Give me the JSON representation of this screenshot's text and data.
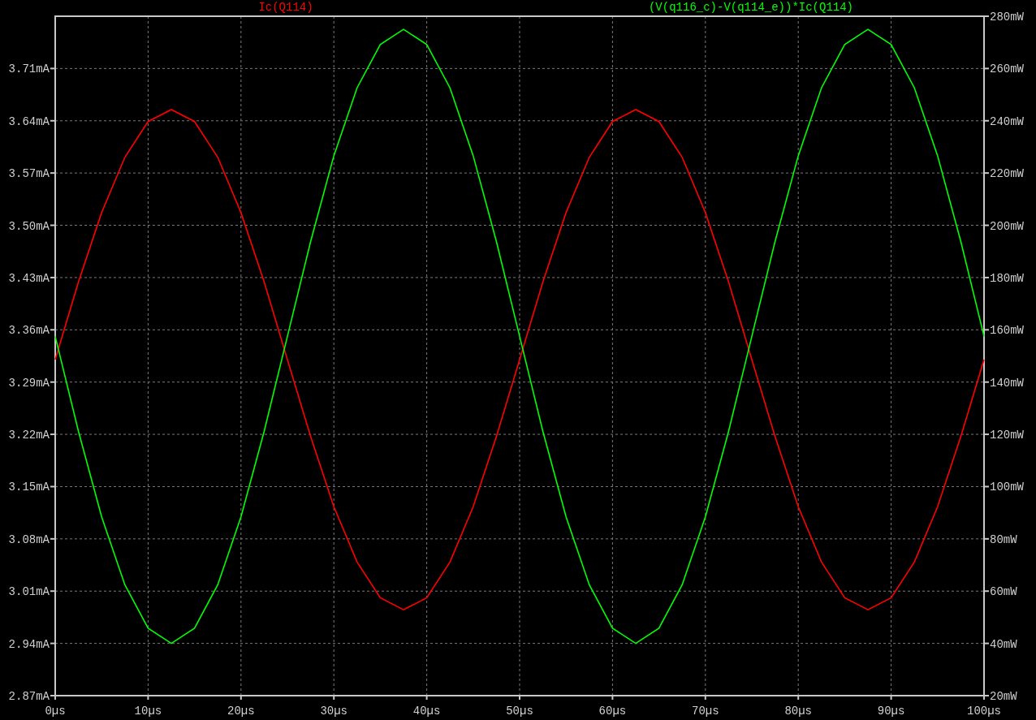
{
  "plot": {
    "chart_data": {
      "type": "line",
      "grid": true,
      "x": [
        0,
        2.5,
        5,
        7.5,
        10,
        12.5,
        15,
        17.5,
        20,
        22.5,
        25,
        27.5,
        30,
        32.5,
        35,
        37.5,
        40,
        42.5,
        45,
        47.5,
        50,
        52.5,
        55,
        57.5,
        60,
        62.5,
        65,
        67.5,
        70,
        72.5,
        75,
        77.5,
        80,
        82.5,
        85,
        87.5,
        90,
        92.5,
        95,
        97.5,
        100
      ],
      "xlim": [
        0,
        100
      ],
      "xticks": [
        {
          "value": 0,
          "label": "0µs"
        },
        {
          "value": 10,
          "label": "10µs"
        },
        {
          "value": 20,
          "label": "20µs"
        },
        {
          "value": 30,
          "label": "30µs"
        },
        {
          "value": 40,
          "label": "40µs"
        },
        {
          "value": 50,
          "label": "50µs"
        },
        {
          "value": 60,
          "label": "60µs"
        },
        {
          "value": 70,
          "label": "70µs"
        },
        {
          "value": 80,
          "label": "80µs"
        },
        {
          "value": 90,
          "label": "90µs"
        },
        {
          "value": 100,
          "label": "100µs"
        }
      ],
      "ylim": [
        2.87,
        3.78
      ],
      "yticks": [
        {
          "value": 2.87,
          "label": "2.87mA"
        },
        {
          "value": 2.94,
          "label": "2.94mA"
        },
        {
          "value": 3.01,
          "label": "3.01mA"
        },
        {
          "value": 3.08,
          "label": "3.08mA"
        },
        {
          "value": 3.15,
          "label": "3.15mA"
        },
        {
          "value": 3.22,
          "label": "3.22mA"
        },
        {
          "value": 3.29,
          "label": "3.29mA"
        },
        {
          "value": 3.36,
          "label": "3.36mA"
        },
        {
          "value": 3.43,
          "label": "3.43mA"
        },
        {
          "value": 3.5,
          "label": "3.50mA"
        },
        {
          "value": 3.57,
          "label": "3.57mA"
        },
        {
          "value": 3.64,
          "label": "3.64mA"
        },
        {
          "value": 3.71,
          "label": "3.71mA"
        }
      ],
      "y2lim": [
        20,
        280
      ],
      "y2ticks": [
        {
          "value": 20,
          "label": "20mW"
        },
        {
          "value": 40,
          "label": "40mW"
        },
        {
          "value": 60,
          "label": "60mW"
        },
        {
          "value": 80,
          "label": "80mW"
        },
        {
          "value": 100,
          "label": "100mW"
        },
        {
          "value": 120,
          "label": "120mW"
        },
        {
          "value": 140,
          "label": "140mW"
        },
        {
          "value": 160,
          "label": "160mW"
        },
        {
          "value": 180,
          "label": "180mW"
        },
        {
          "value": 200,
          "label": "200mW"
        },
        {
          "value": 220,
          "label": "220mW"
        },
        {
          "value": 240,
          "label": "240mW"
        },
        {
          "value": 260,
          "label": "260mW"
        },
        {
          "value": 280,
          "label": "280mW"
        }
      ],
      "series": [
        {
          "name": "Ic(Q114)",
          "color": "#ff0000",
          "values": [
            3.32,
            3.424,
            3.517,
            3.591,
            3.639,
            3.655,
            3.639,
            3.591,
            3.517,
            3.424,
            3.32,
            3.217,
            3.123,
            3.049,
            3.001,
            2.985,
            3.001,
            3.049,
            3.123,
            3.217,
            3.32,
            3.424,
            3.517,
            3.591,
            3.639,
            3.655,
            3.639,
            3.591,
            3.517,
            3.424,
            3.32,
            3.217,
            3.123,
            3.049,
            3.001,
            2.985,
            3.001,
            3.049,
            3.123,
            3.217,
            3.32
          ]
        },
        {
          "name": "(V(q116_c)-V(q114_e))*Ic(Q114)",
          "color": "#00ff00",
          "axis": "y2",
          "values": [
            157.5,
            121.2,
            88.4,
            62.4,
            45.8,
            40,
            45.8,
            62.4,
            88.4,
            121.2,
            157.5,
            193.8,
            226.6,
            252.6,
            269.2,
            275,
            269.2,
            252.6,
            226.6,
            193.8,
            157.5,
            121.2,
            88.4,
            62.4,
            45.8,
            40,
            45.8,
            62.4,
            88.4,
            121.2,
            157.5,
            193.8,
            226.6,
            252.6,
            269.2,
            275,
            269.2,
            252.6,
            226.6,
            193.8,
            157.5
          ]
        }
      ]
    }
  }
}
